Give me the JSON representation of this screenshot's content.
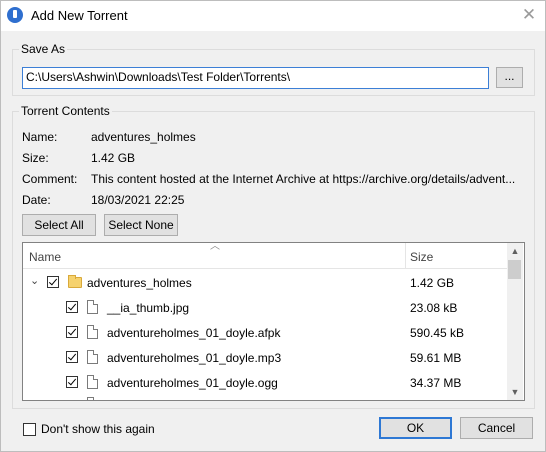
{
  "window": {
    "title": "Add New Torrent"
  },
  "save_as": {
    "label": "Save As",
    "path": "C:\\Users\\Ashwin\\Downloads\\Test Folder\\Torrents\\",
    "browse_label": "..."
  },
  "contents": {
    "label": "Torrent Contents",
    "fields": [
      {
        "label": "Name:",
        "value": "adventures_holmes"
      },
      {
        "label": "Size:",
        "value": "1.42 GB"
      },
      {
        "label": "Comment:",
        "value": "This content hosted at the Internet Archive at https://archive.org/details/advent..."
      },
      {
        "label": "Date:",
        "value": "18/03/2021 22:25"
      }
    ],
    "select_all_label": "Select All",
    "select_none_label": "Select None",
    "columns": {
      "name": "Name",
      "size": "Size"
    },
    "tree": {
      "folder": {
        "name": "adventures_holmes",
        "size": "1.42 GB",
        "checked": true,
        "expanded": true
      },
      "files": [
        {
          "name": "__ia_thumb.jpg",
          "size": "23.08 kB",
          "checked": true
        },
        {
          "name": "adventureholmes_01_doyle.afpk",
          "size": "590.45 kB",
          "checked": true
        },
        {
          "name": "adventureholmes_01_doyle.mp3",
          "size": "59.61 MB",
          "checked": true
        },
        {
          "name": "adventureholmes_01_doyle.ogg",
          "size": "34.37 MB",
          "checked": true
        }
      ]
    }
  },
  "footer": {
    "dont_show_label": "Don't show this again",
    "dont_show_checked": false,
    "ok_label": "OK",
    "cancel_label": "Cancel"
  }
}
